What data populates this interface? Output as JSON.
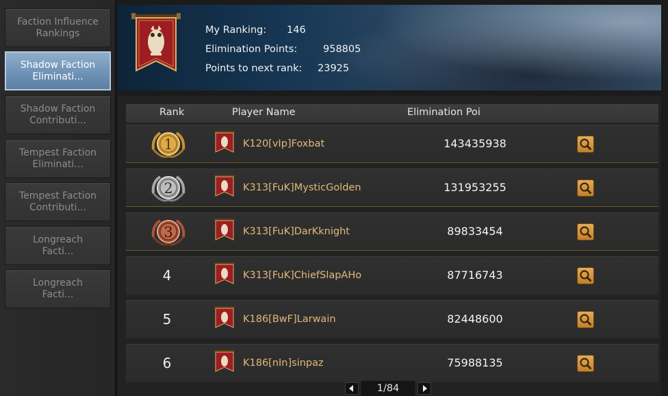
{
  "sidebar": {
    "items": [
      {
        "label": "Faction Influence\nRankings",
        "active": false
      },
      {
        "label": "Shadow Faction\nEliminati...",
        "active": true
      },
      {
        "label": "Shadow Faction\nContributi...",
        "active": false
      },
      {
        "label": "Tempest Faction\nEliminati...",
        "active": false
      },
      {
        "label": "Tempest Faction\nContributi...",
        "active": false
      },
      {
        "label": "Longreach\nFacti...",
        "active": false
      },
      {
        "label": "Longreach\nFacti...",
        "active": false
      }
    ]
  },
  "header": {
    "my_ranking_label": "My Ranking:",
    "my_ranking_value": "146",
    "elim_points_label": "Elimination Points:",
    "elim_points_value": "958805",
    "next_rank_label": "Points to next rank:",
    "next_rank_value": "23925"
  },
  "table": {
    "columns": {
      "rank": "Rank",
      "player": "Player Name",
      "points": "Elimination Poi"
    },
    "rows": [
      {
        "rank": "1",
        "player": "K120[vIp]Foxbat",
        "points": "143435938",
        "medal": "gold"
      },
      {
        "rank": "2",
        "player": "K313[FuK]MysticGolden",
        "points": "131953255",
        "medal": "silver"
      },
      {
        "rank": "3",
        "player": "K313[FuK]DarKknight",
        "points": "89833454",
        "medal": "bronze"
      },
      {
        "rank": "4",
        "player": "K313[FuK]ChiefSlapAHo",
        "points": "87716743",
        "medal": ""
      },
      {
        "rank": "5",
        "player": "K186[BwF]Larwain",
        "points": "82448600",
        "medal": ""
      },
      {
        "rank": "6",
        "player": "K186[nIn]sinpaz",
        "points": "75988135",
        "medal": ""
      }
    ]
  },
  "pagination": {
    "label": "1/84"
  },
  "colors": {
    "accent_gold": "#e3b979",
    "active_tab": "#7a9cbf",
    "medal_gold": "#c9932f",
    "medal_silver": "#a9a9a9",
    "medal_bronze": "#a8553a",
    "banner_red": "#9d1d22"
  },
  "icons": {
    "faction_banner": "owl-banner-icon",
    "search": "magnifier-icon",
    "prev": "triangle-left-icon",
    "next": "triangle-right-icon"
  }
}
